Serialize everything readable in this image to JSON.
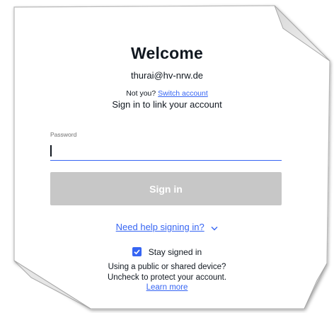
{
  "title": "Welcome",
  "account": {
    "email": "thurai@hv-nrw.de",
    "not_you_text": "Not you?",
    "switch_link": "Switch account"
  },
  "subtitle": "Sign in to link your account",
  "password": {
    "label": "Password",
    "value": "",
    "placeholder": ""
  },
  "signin_button": "Sign in",
  "help_link": "Need help signing in?",
  "stay_signed_in": {
    "label": "Stay signed in",
    "checked": true
  },
  "info": {
    "line1": "Using a public or shared device?",
    "line2": "Uncheck to protect your account.",
    "learn_more": "Learn more"
  },
  "colors": {
    "accent": "#3665f3",
    "button_disabled": "#c7c7c7",
    "text": "#111820"
  },
  "icons": {
    "help_toggle": "chevron-down-icon",
    "checkbox": "checkmark-icon"
  }
}
